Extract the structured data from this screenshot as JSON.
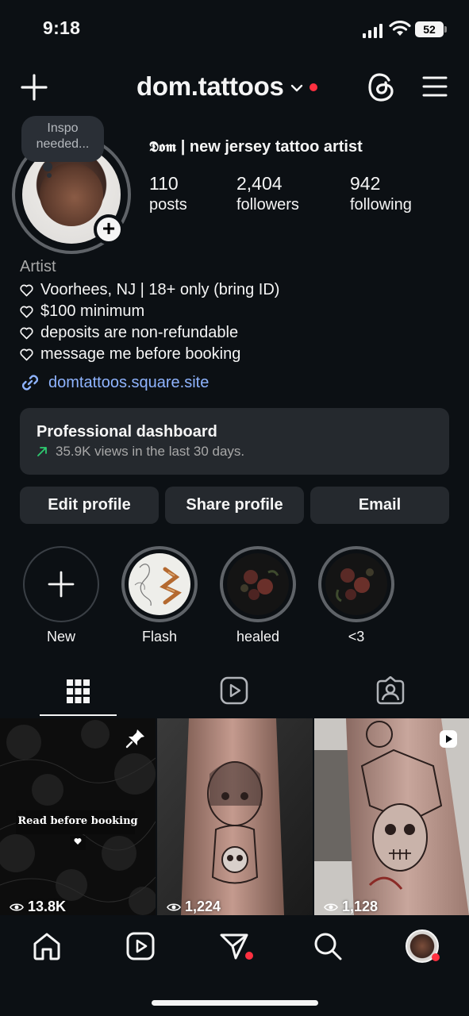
{
  "status_bar": {
    "time": "9:18",
    "battery": "52"
  },
  "header": {
    "username": "dom.tattoos"
  },
  "note": {
    "text_line1": "Inspo",
    "text_line2": "needed..."
  },
  "profile": {
    "display_name_gothic": "𝕯𝖔𝖒",
    "display_name_rest": " | new jersey tattoo artist",
    "stats": [
      {
        "value": "110",
        "label": "posts"
      },
      {
        "value": "2,404",
        "label": "followers"
      },
      {
        "value": "942",
        "label": "following"
      }
    ],
    "category": "Artist",
    "bio_lines": [
      "Voorhees, NJ | 18+ only (bring ID)",
      "$100 minimum",
      "deposits are non-refundable",
      "message me before booking"
    ],
    "link": "domtattoos.square.site"
  },
  "dashboard": {
    "title": "Professional dashboard",
    "subtitle": "35.9K views in the last 30 days."
  },
  "buttons": {
    "edit": "Edit profile",
    "share": "Share profile",
    "email": "Email"
  },
  "highlights": [
    {
      "label": "New"
    },
    {
      "label": "Flash"
    },
    {
      "label": "healed"
    },
    {
      "label": "<3"
    }
  ],
  "posts": [
    {
      "caption": "Read before booking",
      "views": "13.8K"
    },
    {
      "views": "1,224"
    },
    {
      "views": "1,128"
    }
  ],
  "colors": {
    "background": "#0c1014",
    "card": "#25292e",
    "link": "#8fb4ff",
    "notification": "#ff3040",
    "trend": "#2ecc71"
  }
}
